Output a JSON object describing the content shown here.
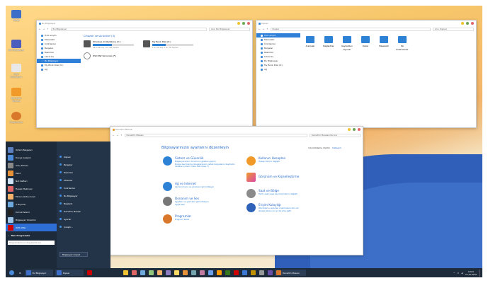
{
  "desktop_icons": [
    {
      "label": "Masa",
      "color": "#3d6fc8"
    },
    {
      "label": "Bu Bilgisayar",
      "color": "#4b5dbd"
    },
    {
      "label": "Geri Dönüşüm",
      "color": "#e8e8e8"
    },
    {
      "label": "Denetim Masası",
      "color": "#f19a2a"
    },
    {
      "label": "Programlar",
      "color": "#d9782a"
    }
  ],
  "explorer1": {
    "title": "Bu Bilgisayar",
    "address": "Bu Bilgisayar",
    "search_placeholder": "Ara: Bu Bilgisayar",
    "sidebar": [
      "Hızlı erişim",
      "Masaüstü",
      "İndirilenler",
      "Belgeler",
      "Resimler",
      "Libraries",
      "Bu Bilgisayar",
      "My Book Disk (K:)",
      "Ağ"
    ],
    "section_header": "Cihazlar ve sürücüler (3)",
    "drives": [
      {
        "name": "Windows 10 Redstone (C:)",
        "free": "58,8 GB boş, 111 GB toplam",
        "fill": 0.47
      },
      {
        "name": "My Book Disk (K:)",
        "free": "1,24 TB boş, 1,81 TB toplam",
        "fill": 0.32
      },
      {
        "name": "DVD RW Sürücüsü (F:)",
        "free": "",
        "fill": 0
      }
    ]
  },
  "explorer2": {
    "title": "Kişisel",
    "address": "Kişisel",
    "search_placeholder": "Ara: Kişisel",
    "sidebar": [
      "Hızlı erişim",
      "Masaüstü",
      "İndirilenler",
      "Belgeler",
      "Resimler",
      "Libraries",
      "Bu Bilgisayar",
      "My Book Disk (K:)",
      "Ağ"
    ],
    "folders": [
      "Aramalar",
      "Bağlantılar",
      "Kaydedilen Oyunlar",
      "Kişiler",
      "Masaüstü",
      "Sık Kullanılanlar"
    ]
  },
  "control_panel": {
    "title": "Denetim Masası",
    "address": "Denetim Masası",
    "search_placeholder": "Denetim Masasında Ara",
    "heading": "Bilgisayarınızın ayarlarını düzenleyin",
    "view_by_label": "Görüntüleme ölçütü:",
    "view_by_value": "Kategori",
    "categories_left": [
      {
        "title": "Sistem ve Güvenlik",
        "color": "#2e82d6",
        "subs": [
          "Bilgisayarınızın durumunu gözden geçirin",
          "Dosya Geçmişi ile dosyalarınızın yedek kopyalarını kaydedin",
          "Yedekle ve Geri Yükle (Windows 7)"
        ]
      },
      {
        "title": "Ağ ve Internet",
        "color": "#2e82d6",
        "subs": [
          "Ağ durumunu ve görevleri görüntüleyin"
        ]
      },
      {
        "title": "Donanım ve Ses",
        "color": "#777777",
        "subs": [
          "Aygıtları ve yazıcıları görüntüleyin",
          "Aygıt ekle"
        ]
      },
      {
        "title": "Programlar",
        "color": "#d9782a",
        "subs": [
          "Program kaldır"
        ]
      }
    ],
    "categories_right": [
      {
        "title": "Kullanıcı Hesapları",
        "color": "#f19a2a",
        "subs": [
          "Hesap türünü değiştir"
        ]
      },
      {
        "title": "Görünüm ve Kişiselleştirme",
        "color": "#d946a8",
        "subs": []
      },
      {
        "title": "Saat ve Bölge",
        "color": "#8a8a8a",
        "subs": [
          "Tarih, saat veya sayı biçimlerini değiştir"
        ]
      },
      {
        "title": "Erişim Kolaylığı",
        "color": "#2e62b8",
        "subs": [
          "Windows'un ayarları önermesine izin ver",
          "Görsel ekranı en iyi duruma getir"
        ]
      }
    ]
  },
  "start_menu": {
    "left_items": [
      "Ortam Belgeleri",
      "Dosya Gezgini",
      "Araç Kutusu",
      "Paint",
      "Not Defteri",
      "Hesap Makinesi",
      "Ekran Alıntısı Aracı",
      "3 Boyutlu",
      "Komut İstemi",
      "Bilgisayar Yönetimi",
      "WPS Ofisi"
    ],
    "all_programs": "Tüm Programlar",
    "search_placeholder": "Programlarda ve dosyalarda ara",
    "right_items": [
      "Kişisel",
      "Belgeler",
      "Resimler",
      "Müzikler",
      "İndirilenler",
      "Bu Bilgisayar",
      "Bağlantı",
      "Denetim Masası",
      "Ayarlar",
      "Çalıştır..."
    ],
    "shutdown_label": "Bilgisayarı kapat"
  },
  "taskbar": {
    "apps": [
      {
        "label": "Bu Bilgisayar",
        "color": "#3d6fc8"
      },
      {
        "label": "Kişisel",
        "color": "#3d6fc8"
      },
      {
        "label": "Denetim Masası",
        "color": "#d9782a"
      }
    ],
    "pinned_colors": [
      "#f1c232",
      "#e06666",
      "#6fa8dc",
      "#93c47d",
      "#f6b26b",
      "#8e7cc3",
      "#ffd966",
      "#e69138",
      "#76a5af",
      "#c27ba0",
      "#6d9eeb",
      "#ff9900",
      "#38761d",
      "#cc0000",
      "#3c78d8",
      "#bf9000",
      "#999999",
      "#674ea7"
    ],
    "time": "19:01",
    "date": "21.10.2016"
  }
}
